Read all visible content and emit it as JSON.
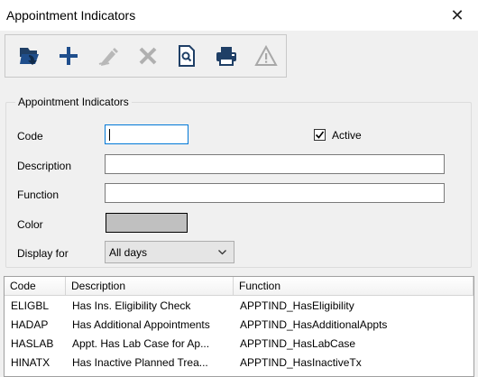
{
  "window": {
    "title": "Appointment Indicators",
    "close_glyph": "✕"
  },
  "toolbar": {
    "buttons": [
      {
        "name": "open-icon",
        "enabled": true
      },
      {
        "name": "add-icon",
        "enabled": true
      },
      {
        "name": "edit-icon",
        "enabled": false
      },
      {
        "name": "delete-icon",
        "enabled": false
      },
      {
        "name": "preview-icon",
        "enabled": true
      },
      {
        "name": "print-icon",
        "enabled": true
      },
      {
        "name": "warning-icon",
        "enabled": false
      }
    ]
  },
  "form": {
    "legend": "Appointment Indicators",
    "code_label": "Code",
    "code_value": "",
    "active_label": "Active",
    "active_checked": true,
    "description_label": "Description",
    "description_value": "",
    "function_label": "Function",
    "function_value": "",
    "color_label": "Color",
    "color_value": "#c0c0c0",
    "display_for_label": "Display for",
    "display_for_value": "All days"
  },
  "grid": {
    "columns": [
      "Code",
      "Description",
      "Function"
    ],
    "rows": [
      [
        "ELIGBL",
        "Has Ins. Eligibility Check",
        "APPTIND_HasEligibility"
      ],
      [
        "HADAP",
        "Has Additional Appointments",
        "APPTIND_HasAdditionalAppts"
      ],
      [
        "HASLAB",
        "Appt. Has Lab Case for Ap...",
        "APPTIND_HasLabCase"
      ],
      [
        "HINATX",
        "Has Inactive Planned Trea...",
        "APPTIND_HasInactiveTx"
      ]
    ]
  }
}
